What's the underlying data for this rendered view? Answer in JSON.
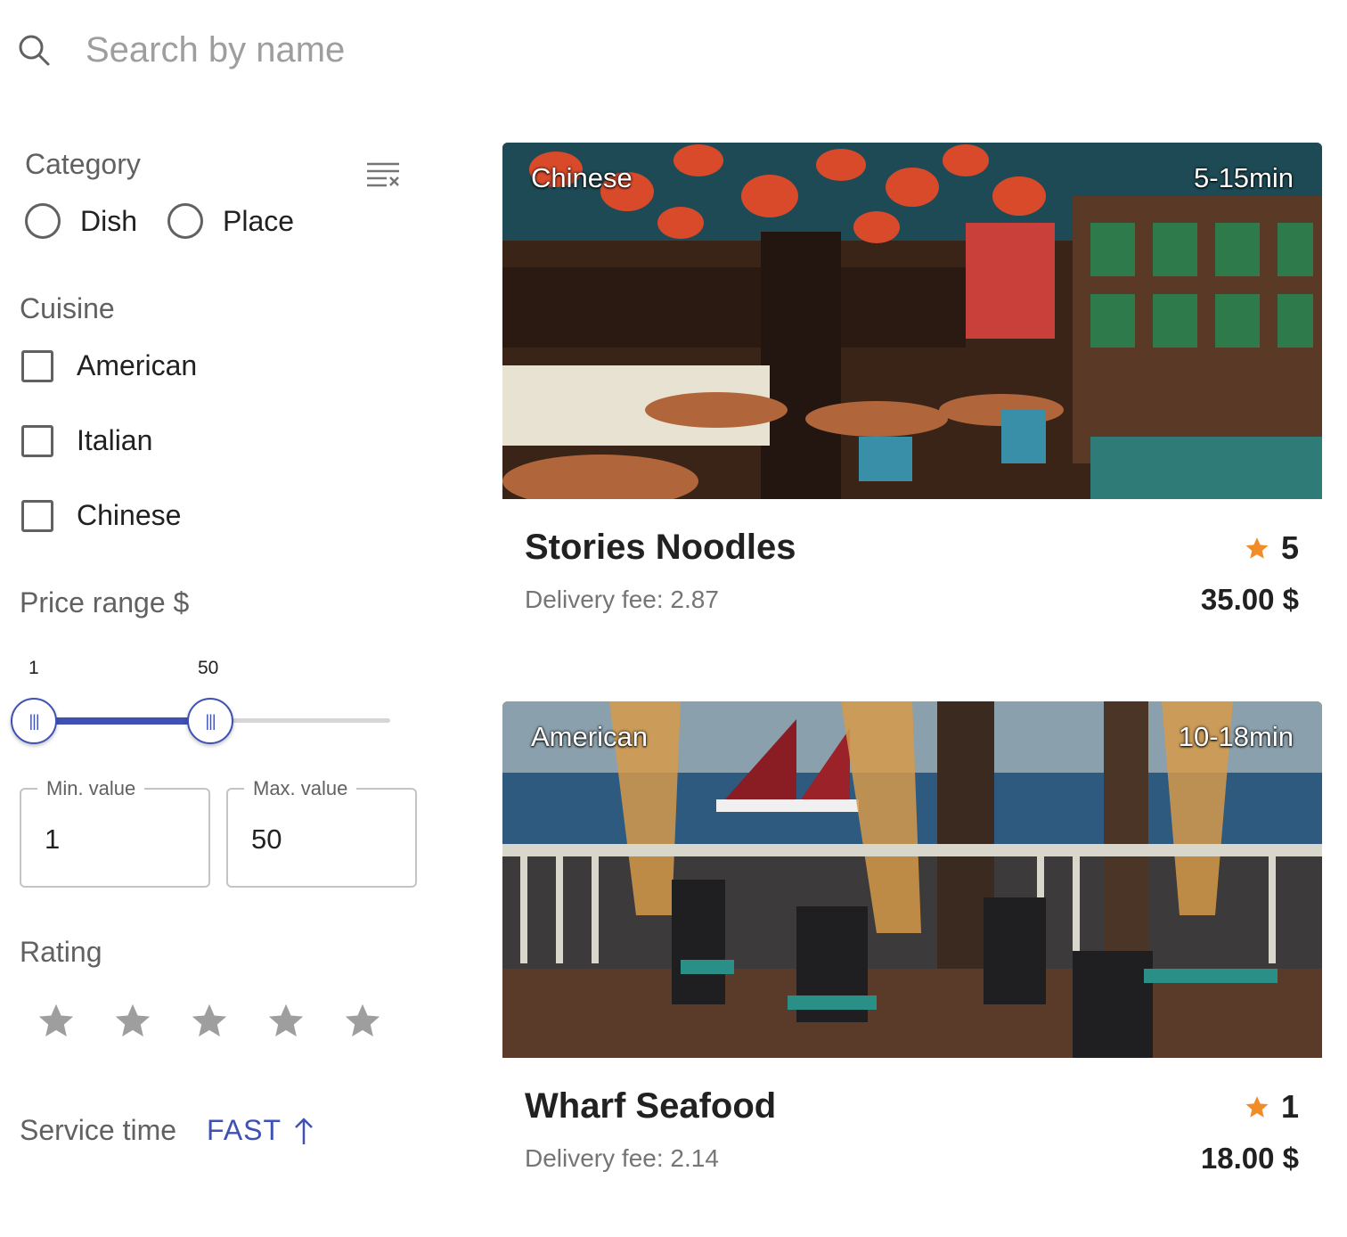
{
  "search": {
    "placeholder": "Search by name"
  },
  "filters": {
    "category": {
      "label": "Category",
      "options": [
        {
          "label": "Dish",
          "selected": false
        },
        {
          "label": "Place",
          "selected": false
        }
      ]
    },
    "cuisine": {
      "label": "Cuisine",
      "options": [
        {
          "label": "American",
          "checked": false
        },
        {
          "label": "Italian",
          "checked": false
        },
        {
          "label": "Chinese",
          "checked": false
        }
      ]
    },
    "price": {
      "label": "Price range $",
      "range_min": "1",
      "range_max": "50",
      "min_label": "Min. value",
      "min_value": "1",
      "max_label": "Max. value",
      "max_value": "50"
    },
    "rating": {
      "label": "Rating",
      "selected_stars": 0,
      "total_stars": 5
    },
    "service_time": {
      "label": "Service time",
      "sort_label": "FAST"
    }
  },
  "restaurants": [
    {
      "cuisine": "Chinese",
      "delivery_time": "5-15min",
      "name": "Stories Noodles",
      "rating": "5",
      "delivery_fee": "Delivery fee: 2.87",
      "price": "35.00 $"
    },
    {
      "cuisine": "American",
      "delivery_time": "10-18min",
      "name": "Wharf Seafood",
      "rating": "1",
      "delivery_fee": "Delivery fee: 2.14",
      "price": "18.00 $"
    }
  ],
  "colors": {
    "accent": "#3f51b5",
    "star_active": "#f28c28",
    "star_inactive": "#9e9e9e"
  }
}
